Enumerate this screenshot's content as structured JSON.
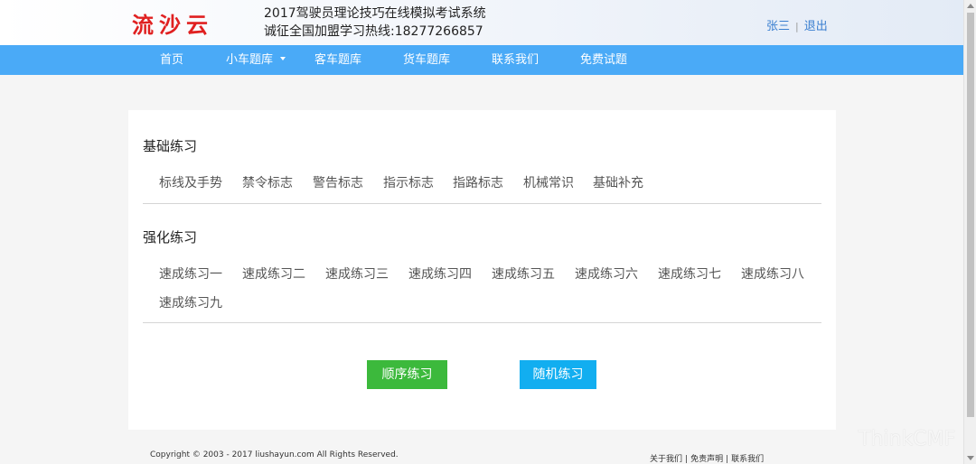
{
  "header": {
    "logo": "流沙云",
    "title_line1": "2017驾驶员理论技巧在线模拟考试系统",
    "title_line2": "诚征全国加盟学习热线:18277266857",
    "user_name": "张三",
    "user_sep": "|",
    "logout": "退出"
  },
  "nav": {
    "items": [
      "首页",
      "小车题库",
      "客车题库",
      "货车题库",
      "联系我们",
      "免费试题"
    ]
  },
  "basic": {
    "title": "基础练习",
    "items": [
      "标线及手势",
      "禁令标志",
      "警告标志",
      "指示标志",
      "指路标志",
      "机械常识",
      "基础补充"
    ]
  },
  "advanced": {
    "title": "强化练习",
    "items": [
      "速成练习一",
      "速成练习二",
      "速成练习三",
      "速成练习四",
      "速成练习五",
      "速成练习六",
      "速成练习七",
      "速成练习八",
      "速成练习九"
    ]
  },
  "buttons": {
    "sequential": "顺序练习",
    "random": "随机练习",
    "sequential_color": "#3cb93c",
    "random_color": "#12aef0"
  },
  "footer": {
    "copyright": "Copyright © 2003 - 2017 liushayun.com All Rights Reserved.",
    "links": [
      "关于我们",
      "免责声明",
      "联系我们"
    ],
    "sep": "|"
  },
  "watermark": "ThinkCMF",
  "colors": {
    "nav": "#4aaaf7",
    "logo": "#e02020",
    "user_link": "#3a7fd0"
  }
}
